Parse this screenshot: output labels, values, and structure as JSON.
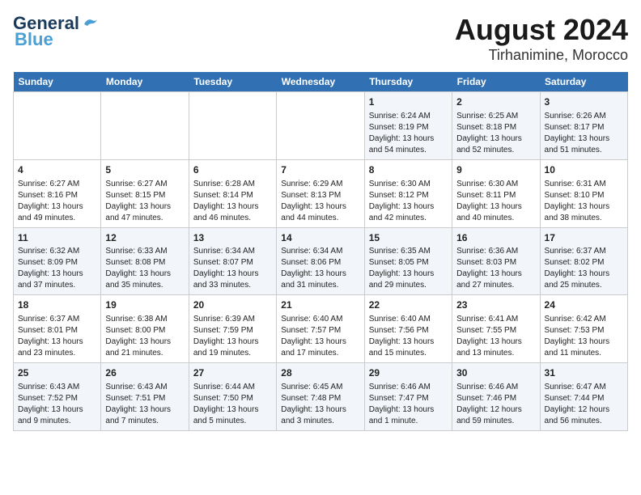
{
  "header": {
    "logo_line1": "General",
    "logo_line2": "Blue",
    "title": "August 2024",
    "subtitle": "Tirhanimine, Morocco"
  },
  "days_of_week": [
    "Sunday",
    "Monday",
    "Tuesday",
    "Wednesday",
    "Thursday",
    "Friday",
    "Saturday"
  ],
  "weeks": [
    [
      {
        "num": "",
        "info": ""
      },
      {
        "num": "",
        "info": ""
      },
      {
        "num": "",
        "info": ""
      },
      {
        "num": "",
        "info": ""
      },
      {
        "num": "1",
        "info": "Sunrise: 6:24 AM\nSunset: 8:19 PM\nDaylight: 13 hours\nand 54 minutes."
      },
      {
        "num": "2",
        "info": "Sunrise: 6:25 AM\nSunset: 8:18 PM\nDaylight: 13 hours\nand 52 minutes."
      },
      {
        "num": "3",
        "info": "Sunrise: 6:26 AM\nSunset: 8:17 PM\nDaylight: 13 hours\nand 51 minutes."
      }
    ],
    [
      {
        "num": "4",
        "info": "Sunrise: 6:27 AM\nSunset: 8:16 PM\nDaylight: 13 hours\nand 49 minutes."
      },
      {
        "num": "5",
        "info": "Sunrise: 6:27 AM\nSunset: 8:15 PM\nDaylight: 13 hours\nand 47 minutes."
      },
      {
        "num": "6",
        "info": "Sunrise: 6:28 AM\nSunset: 8:14 PM\nDaylight: 13 hours\nand 46 minutes."
      },
      {
        "num": "7",
        "info": "Sunrise: 6:29 AM\nSunset: 8:13 PM\nDaylight: 13 hours\nand 44 minutes."
      },
      {
        "num": "8",
        "info": "Sunrise: 6:30 AM\nSunset: 8:12 PM\nDaylight: 13 hours\nand 42 minutes."
      },
      {
        "num": "9",
        "info": "Sunrise: 6:30 AM\nSunset: 8:11 PM\nDaylight: 13 hours\nand 40 minutes."
      },
      {
        "num": "10",
        "info": "Sunrise: 6:31 AM\nSunset: 8:10 PM\nDaylight: 13 hours\nand 38 minutes."
      }
    ],
    [
      {
        "num": "11",
        "info": "Sunrise: 6:32 AM\nSunset: 8:09 PM\nDaylight: 13 hours\nand 37 minutes."
      },
      {
        "num": "12",
        "info": "Sunrise: 6:33 AM\nSunset: 8:08 PM\nDaylight: 13 hours\nand 35 minutes."
      },
      {
        "num": "13",
        "info": "Sunrise: 6:34 AM\nSunset: 8:07 PM\nDaylight: 13 hours\nand 33 minutes."
      },
      {
        "num": "14",
        "info": "Sunrise: 6:34 AM\nSunset: 8:06 PM\nDaylight: 13 hours\nand 31 minutes."
      },
      {
        "num": "15",
        "info": "Sunrise: 6:35 AM\nSunset: 8:05 PM\nDaylight: 13 hours\nand 29 minutes."
      },
      {
        "num": "16",
        "info": "Sunrise: 6:36 AM\nSunset: 8:03 PM\nDaylight: 13 hours\nand 27 minutes."
      },
      {
        "num": "17",
        "info": "Sunrise: 6:37 AM\nSunset: 8:02 PM\nDaylight: 13 hours\nand 25 minutes."
      }
    ],
    [
      {
        "num": "18",
        "info": "Sunrise: 6:37 AM\nSunset: 8:01 PM\nDaylight: 13 hours\nand 23 minutes."
      },
      {
        "num": "19",
        "info": "Sunrise: 6:38 AM\nSunset: 8:00 PM\nDaylight: 13 hours\nand 21 minutes."
      },
      {
        "num": "20",
        "info": "Sunrise: 6:39 AM\nSunset: 7:59 PM\nDaylight: 13 hours\nand 19 minutes."
      },
      {
        "num": "21",
        "info": "Sunrise: 6:40 AM\nSunset: 7:57 PM\nDaylight: 13 hours\nand 17 minutes."
      },
      {
        "num": "22",
        "info": "Sunrise: 6:40 AM\nSunset: 7:56 PM\nDaylight: 13 hours\nand 15 minutes."
      },
      {
        "num": "23",
        "info": "Sunrise: 6:41 AM\nSunset: 7:55 PM\nDaylight: 13 hours\nand 13 minutes."
      },
      {
        "num": "24",
        "info": "Sunrise: 6:42 AM\nSunset: 7:53 PM\nDaylight: 13 hours\nand 11 minutes."
      }
    ],
    [
      {
        "num": "25",
        "info": "Sunrise: 6:43 AM\nSunset: 7:52 PM\nDaylight: 13 hours\nand 9 minutes."
      },
      {
        "num": "26",
        "info": "Sunrise: 6:43 AM\nSunset: 7:51 PM\nDaylight: 13 hours\nand 7 minutes."
      },
      {
        "num": "27",
        "info": "Sunrise: 6:44 AM\nSunset: 7:50 PM\nDaylight: 13 hours\nand 5 minutes."
      },
      {
        "num": "28",
        "info": "Sunrise: 6:45 AM\nSunset: 7:48 PM\nDaylight: 13 hours\nand 3 minutes."
      },
      {
        "num": "29",
        "info": "Sunrise: 6:46 AM\nSunset: 7:47 PM\nDaylight: 13 hours\nand 1 minute."
      },
      {
        "num": "30",
        "info": "Sunrise: 6:46 AM\nSunset: 7:46 PM\nDaylight: 12 hours\nand 59 minutes."
      },
      {
        "num": "31",
        "info": "Sunrise: 6:47 AM\nSunset: 7:44 PM\nDaylight: 12 hours\nand 56 minutes."
      }
    ]
  ]
}
